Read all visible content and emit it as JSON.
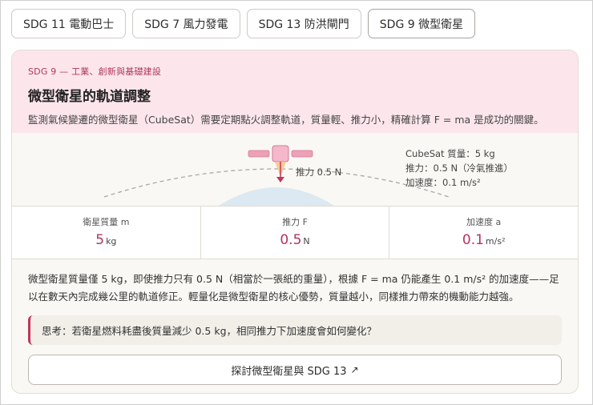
{
  "tabs": [
    {
      "label": "SDG 11 電動巴士"
    },
    {
      "label": "SDG 7 風力發電"
    },
    {
      "label": "SDG 13 防洪閘門"
    },
    {
      "label": "SDG 9 微型衛星",
      "active": true
    }
  ],
  "hero": {
    "kicker": "SDG 9 — 工業、創新與基礎建設",
    "title": "微型衛星的軌道調整",
    "description": "監測氣候變遷的微型衛星（CubeSat）需要定期點火調整軌道，質量輕、推力小，精確計算 F = ma 是成功的關鍵。"
  },
  "diagram": {
    "thrust_label": "推力 0.5 N",
    "info_mass": "CubeSat 質量：5 kg",
    "info_thrust": "推力：0.5 N（冷氣推進）",
    "info_accel": "加速度：0.1 m/s²"
  },
  "stats": [
    {
      "label": "衛星質量 m",
      "value": "5",
      "unit": "kg"
    },
    {
      "label": "推力 F",
      "value": "0.5",
      "unit": "N"
    },
    {
      "label": "加速度 a",
      "value": "0.1",
      "unit": "m/s²"
    }
  ],
  "body_text": "微型衛星質量僅 5 kg，即使推力只有 0.5 N（相當於一張紙的重量），根據 F = ma 仍能產生 0.1 m/s² 的加速度——足以在數天內完成幾公里的軌道修正。輕量化是微型衛星的核心優勢，質量越小，同樣推力帶來的機動能力越強。",
  "think_prompt": "思考：若衛星燃料耗盡後質量減少 0.5 kg，相同推力下加速度會如何變化？",
  "cta": {
    "label": "探討微型衛星與 SDG 13",
    "icon": "↗"
  },
  "colors": {
    "accent": "#b0365a",
    "hero_bg": "#fce6ec",
    "satellite": "#eea0b8"
  }
}
